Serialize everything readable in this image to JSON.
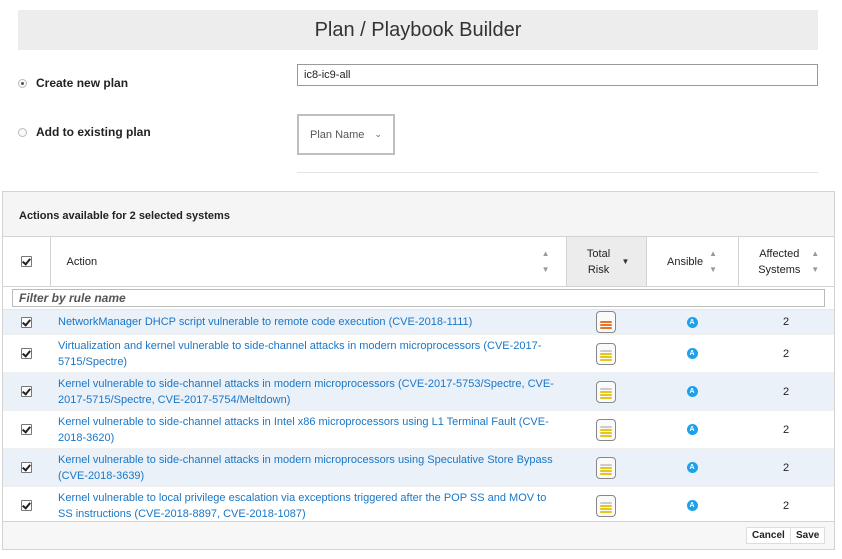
{
  "header": {
    "title": "Plan / Playbook Builder"
  },
  "create_new": {
    "label": "Create new plan",
    "selected": true,
    "input_value": "ic8-ic9-all"
  },
  "add_existing": {
    "label": "Add to existing plan",
    "selected": false,
    "select_value": "Plan Name"
  },
  "panel": {
    "title": "Actions available for 2 selected systems"
  },
  "table": {
    "columns": [
      "Action",
      "Total Risk",
      "Ansible",
      "Affected Systems"
    ],
    "filter_placeholder": "Filter by rule name",
    "rows": [
      {
        "action": "NetworkManager DHCP script vulnerable to remote code execution (CVE-2018-1111)",
        "risk": "high",
        "ansible": "A",
        "affected": "2"
      },
      {
        "action": "Virtualization and kernel vulnerable to side-channel attacks in modern microprocessors (CVE-2017-5715/Spectre)",
        "risk": "medium",
        "ansible": "A",
        "affected": "2"
      },
      {
        "action": "Kernel vulnerable to side-channel attacks in modern microprocessors (CVE-2017-5753/Spectre, CVE-2017-5715/Spectre, CVE-2017-5754/Meltdown)",
        "risk": "medium",
        "ansible": "A",
        "affected": "2"
      },
      {
        "action": "Kernel vulnerable to side-channel attacks in Intel x86 microprocessors using L1 Terminal Fault (CVE-2018-3620)",
        "risk": "medium",
        "ansible": "A",
        "affected": "2"
      },
      {
        "action": "Kernel vulnerable to side-channel attacks in modern microprocessors using Speculative Store Bypass (CVE-2018-3639)",
        "risk": "medium",
        "ansible": "A",
        "affected": "2"
      },
      {
        "action": "Kernel vulnerable to local privilege escalation via exceptions triggered after the POP SS and MOV to SS instructions (CVE-2018-8897, CVE-2018-1087)",
        "risk": "medium",
        "ansible": "A",
        "affected": "2"
      }
    ]
  },
  "footer": {
    "cancel_label": "Cancel",
    "save_label": "Save"
  },
  "colors": {
    "link": "#1a76c6",
    "row_alt": "#ebf1f8",
    "ansible": "#1fa0e8",
    "risk_high": "#e8742a",
    "risk_medium": "#e6c619"
  }
}
